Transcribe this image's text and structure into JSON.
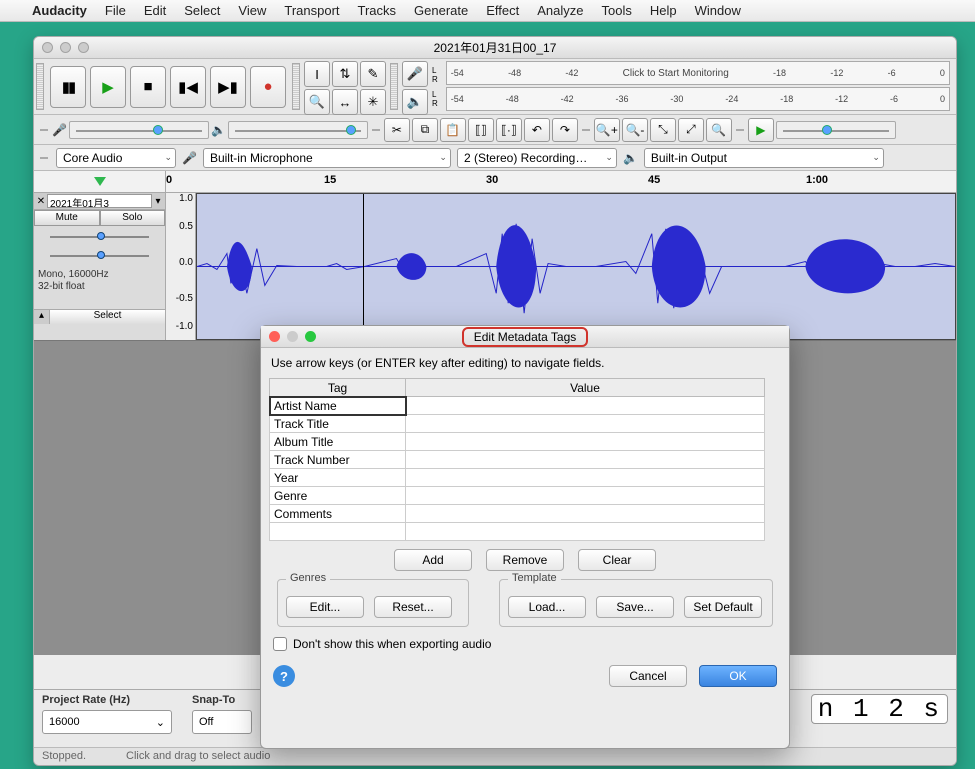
{
  "menubar": {
    "app": "Audacity",
    "items": [
      "File",
      "Edit",
      "Select",
      "View",
      "Transport",
      "Tracks",
      "Generate",
      "Effect",
      "Analyze",
      "Tools",
      "Help",
      "Window"
    ]
  },
  "window": {
    "title": "2021年01月31日00_17"
  },
  "transport": {
    "pause": "⏸",
    "play": "▶",
    "stop": "■",
    "start": "⏮",
    "end": "⏭",
    "record": "●"
  },
  "tools": {
    "selection": "I",
    "envelope": "✦",
    "draw": "✎",
    "zoom": "🔍",
    "timeshift": "↔",
    "multi": "✳"
  },
  "meter": {
    "rec_hint": "Click to Start Monitoring",
    "ticks": [
      "-54",
      "-48",
      "-42",
      "-36",
      "-30",
      "-24",
      "-18",
      "-12",
      "-6",
      "0"
    ],
    "ticks_top": [
      "-54",
      "-48",
      "-42",
      "",
      "",
      "",
      "-18",
      "-12",
      "-6",
      "0"
    ]
  },
  "devices": {
    "host": "Core Audio",
    "rec": "Built-in Microphone",
    "channels": "2 (Stereo) Recording…",
    "play": "Built-in Output"
  },
  "ruler": {
    "t0": "0",
    "t15": "15",
    "t30": "30",
    "t45": "45",
    "t60": "1:00"
  },
  "track": {
    "name": "2021年01月3",
    "mute": "Mute",
    "solo": "Solo",
    "info1": "Mono, 16000Hz",
    "info2": "32-bit float",
    "select": "Select",
    "amp": [
      "1.0",
      "0.5",
      "0.0",
      "-0.5",
      "-1.0"
    ]
  },
  "bottom": {
    "rate_label": "Project Rate (Hz)",
    "rate": "16000",
    "snap_label": "Snap-To",
    "snap_value": "Off",
    "time": "n 1 2 s"
  },
  "status": {
    "state": "Stopped.",
    "hint": "Click and drag to select audio"
  },
  "dialog": {
    "title": "Edit Metadata Tags",
    "hint": "Use arrow keys (or ENTER key after editing) to navigate fields.",
    "th_tag": "Tag",
    "th_val": "Value",
    "rows": [
      "Artist Name",
      "Track Title",
      "Album Title",
      "Track Number",
      "Year",
      "Genre",
      "Comments"
    ],
    "add": "Add",
    "remove": "Remove",
    "clear": "Clear",
    "genres_title": "Genres",
    "edit": "Edit...",
    "reset": "Reset...",
    "template_title": "Template",
    "load": "Load...",
    "save": "Save...",
    "set_default": "Set Default",
    "dont_show": "Don't show this when exporting audio",
    "cancel": "Cancel",
    "ok": "OK"
  },
  "icons": {
    "apple": "",
    "mic": "🎤",
    "spk": "🔊",
    "dd": "▾"
  }
}
